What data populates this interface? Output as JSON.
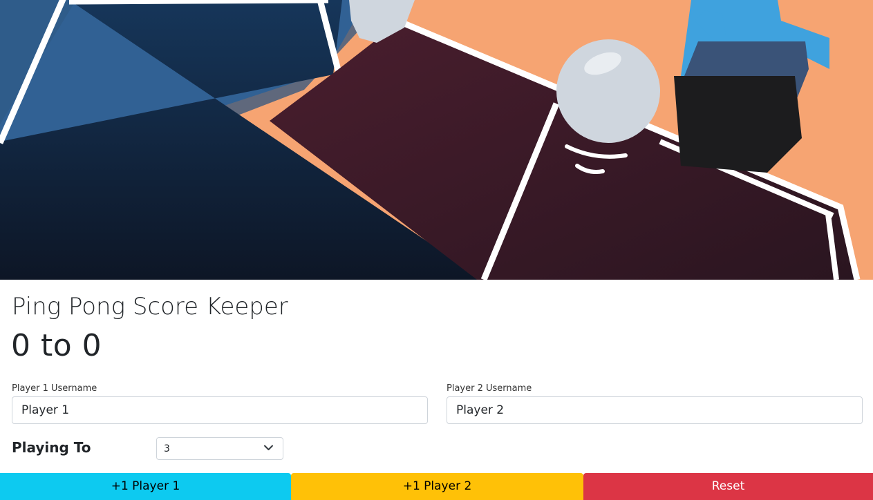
{
  "hero": {
    "icon": "ping-pong-illustration"
  },
  "header": {
    "title": "Ping Pong Score Keeper"
  },
  "score": {
    "player1": "0",
    "separator": "to",
    "player2": "0"
  },
  "form": {
    "player1_label": "Player 1 Username",
    "player1_value": "Player 1",
    "player2_label": "Player 2 Username",
    "player2_value": "Player 2",
    "playing_to_label": "Playing To",
    "playing_to_value": "3"
  },
  "buttons": {
    "player1": "+1 Player 1",
    "player2": "+1 Player 2",
    "reset": "Reset"
  },
  "colors": {
    "player1_button": "#0dcaf0",
    "player2_button": "#ffc107",
    "reset_button": "#dc3545"
  }
}
